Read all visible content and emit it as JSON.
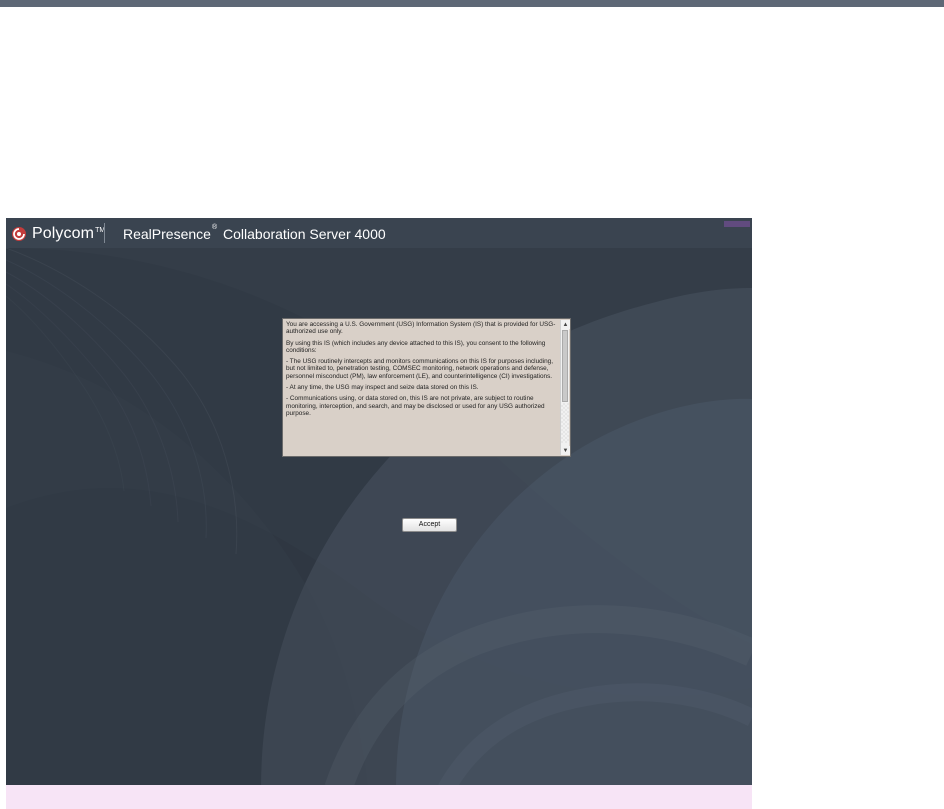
{
  "header": {
    "brand": "Polycom",
    "product_prefix": "RealPresence",
    "product_suffix": "Collaboration Server 4000"
  },
  "consent": {
    "paragraph1": "You are accessing a U.S. Government (USG) Information System (IS) that is provided for USG-authorized use only.",
    "paragraph2": "By using this IS (which includes any device attached to this IS), you consent to the following conditions:",
    "paragraph3": "- The USG routinely intercepts and monitors communications on this IS for purposes including, but not limited to, penetration testing, COMSEC monitoring, network operations and defense, personnel misconduct (PM), law enforcement (LE), and counterintelligence (CI) investigations.",
    "paragraph4": "- At any time, the USG may inspect and seize data stored on this IS.",
    "paragraph5": "- Communications using, or data stored on, this IS are not private, are subject to routine monitoring, interception, and search, and may be disclosed or used for any USG authorized purpose."
  },
  "actions": {
    "accept_label": "Accept"
  },
  "icons": {
    "logo": "polycom-logo-icon",
    "scroll_up": "scroll-up-icon",
    "scroll_down": "scroll-down-icon"
  },
  "colors": {
    "window_background": "#343d48",
    "header_background": "#3a4450",
    "consent_background": "#d9d0c8",
    "bottom_strip": "#f7e4f6",
    "accent": "#6c4e8b"
  }
}
